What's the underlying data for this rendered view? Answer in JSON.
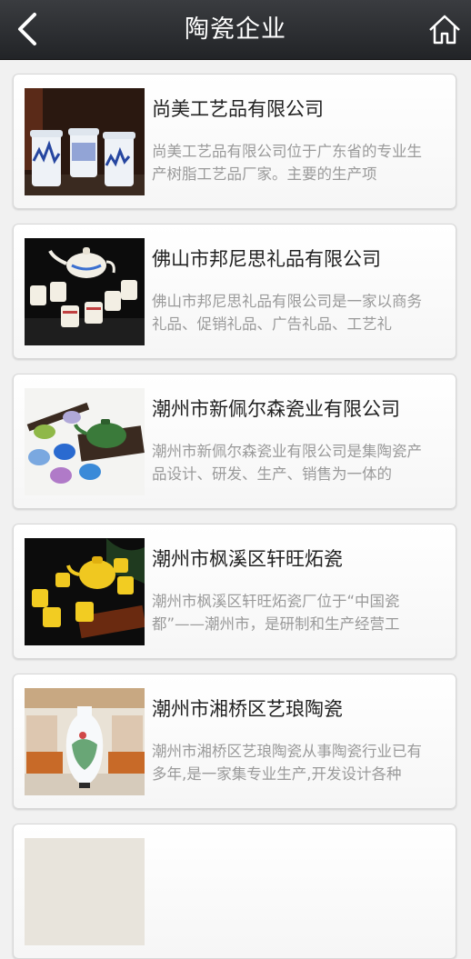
{
  "header": {
    "title": "陶瓷企业",
    "back_icon": "chevron-left-icon",
    "home_icon": "home-icon"
  },
  "companies": [
    {
      "name": "尚美工艺品有限公司",
      "desc": "尚美工艺品有限公司位于广东省的专业生产树脂工艺品厂家。主要的生产项"
    },
    {
      "name": "佛山市邦尼思礼品有限公司",
      "desc": "佛山市邦尼思礼品有限公司是一家以商务礼品、促销礼品、广告礼品、工艺礼"
    },
    {
      "name": "潮州市新佩尔森瓷业有限公司",
      "desc": "潮州市新佩尔森瓷业有限公司是集陶瓷产品设计、研发、生产、销售为一体的"
    },
    {
      "name": "潮州市枫溪区轩旺炻瓷",
      "desc": "潮州市枫溪区轩旺炻瓷厂位于“中国瓷都”——潮州市，是研制和生产经营工"
    },
    {
      "name": "潮州市湘桥区艺琅陶瓷",
      "desc": "潮州市湘桥区艺琅陶瓷从事陶瓷行业已有多年,是一家集专业生产,开发设计各种"
    }
  ],
  "colors": {
    "header_bg": "#2c2e31",
    "title_text": "#ffffff",
    "desc_text": "#9a9a9a"
  }
}
